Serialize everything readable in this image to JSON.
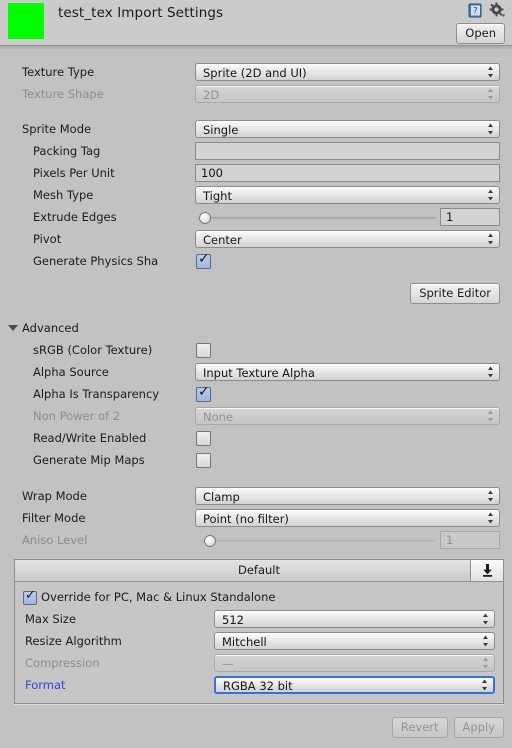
{
  "header": {
    "title": "test_tex Import Settings",
    "thumbnail_color": "#00ff00",
    "help_icon": "help-book-icon",
    "gear_icon": "gear-icon",
    "open_label": "Open"
  },
  "texture": {
    "type_label": "Texture Type",
    "type_value": "Sprite (2D and UI)",
    "shape_label": "Texture Shape",
    "shape_value": "2D"
  },
  "sprite": {
    "mode_label": "Sprite Mode",
    "mode_value": "Single",
    "packing_tag_label": "Packing Tag",
    "packing_tag_value": "",
    "ppu_label": "Pixels Per Unit",
    "ppu_value": "100",
    "mesh_label": "Mesh Type",
    "mesh_value": "Tight",
    "extrude_label": "Extrude Edges",
    "extrude_value": "1",
    "extrude_percent": 3,
    "pivot_label": "Pivot",
    "pivot_value": "Center",
    "physics_label": "Generate Physics Sha",
    "physics_checked": true,
    "sprite_editor_label": "Sprite Editor"
  },
  "advanced": {
    "section_label": "Advanced",
    "srgb_label": "sRGB (Color Texture)",
    "srgb_checked": false,
    "alpha_source_label": "Alpha Source",
    "alpha_source_value": "Input Texture Alpha",
    "alpha_transparency_label": "Alpha Is Transparency",
    "alpha_transparency_checked": true,
    "npot_label": "Non Power of 2",
    "npot_value": "None",
    "readwrite_label": "Read/Write Enabled",
    "readwrite_checked": false,
    "mipmaps_label": "Generate Mip Maps",
    "mipmaps_checked": false
  },
  "filtering": {
    "wrap_label": "Wrap Mode",
    "wrap_value": "Clamp",
    "filter_label": "Filter Mode",
    "filter_value": "Point (no filter)",
    "aniso_label": "Aniso Level",
    "aniso_value": "1",
    "aniso_percent": 5
  },
  "platform": {
    "tab_label": "Default",
    "download_icon": "download-arrow-icon",
    "override_label": "Override for PC, Mac & Linux Standalone",
    "override_checked": true,
    "max_size_label": "Max Size",
    "max_size_value": "512",
    "resize_label": "Resize Algorithm",
    "resize_value": "Mitchell",
    "compression_label": "Compression",
    "compression_value": "—",
    "format_label": "Format",
    "format_value": "RGBA 32 bit",
    "format_label_color": "#2f49d6"
  },
  "footer": {
    "revert_label": "Revert",
    "apply_label": "Apply"
  }
}
